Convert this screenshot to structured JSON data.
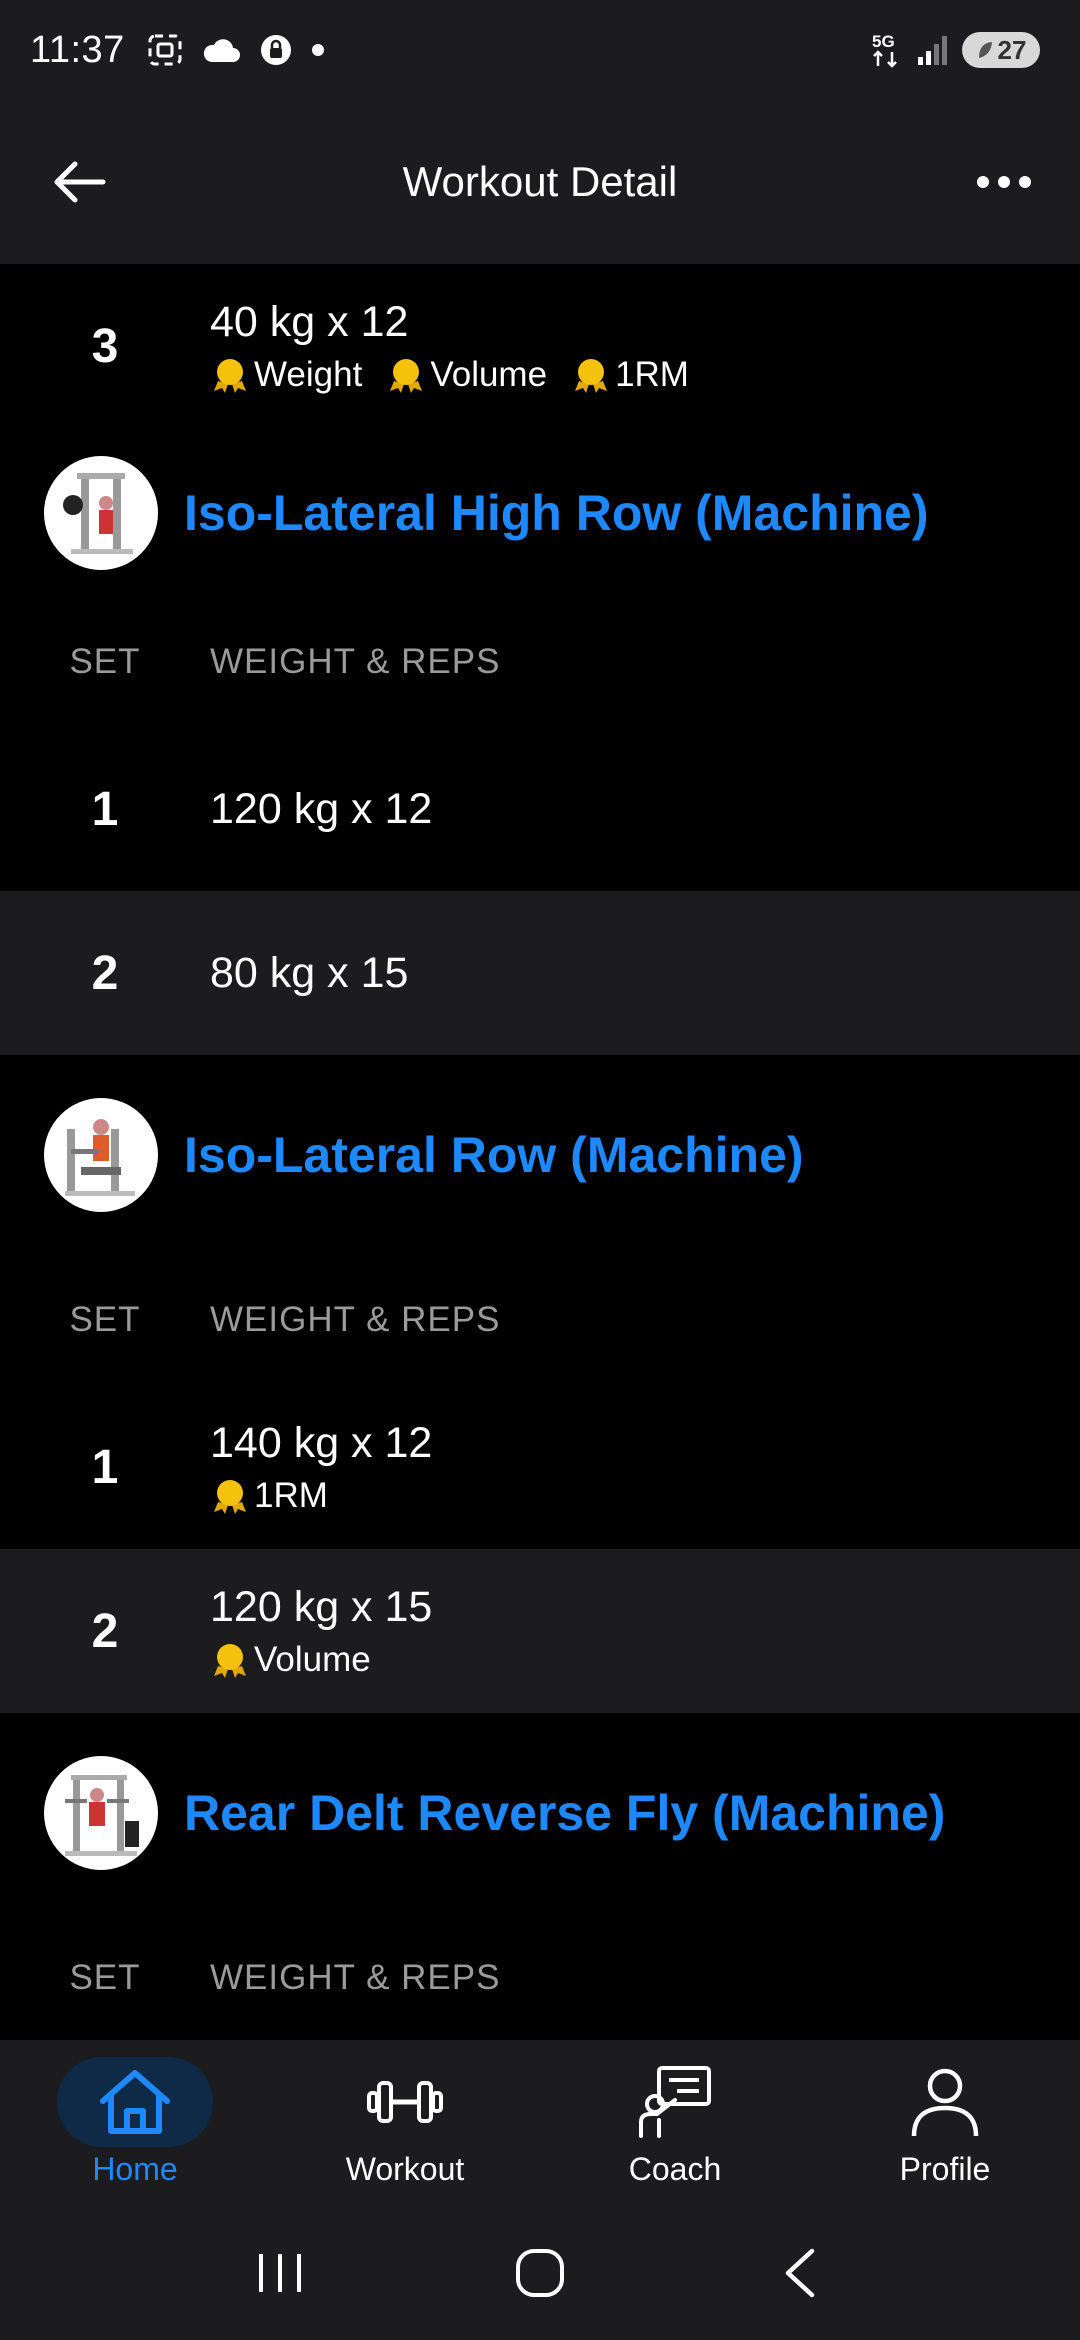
{
  "status_bar": {
    "time": "11:37",
    "network": "5G",
    "battery": "27"
  },
  "app_bar": {
    "title": "Workout Detail"
  },
  "top_set": {
    "number": "3",
    "value": "40 kg x 12",
    "badges": [
      "Weight",
      "Volume",
      "1RM"
    ]
  },
  "exercises": [
    {
      "name": "Iso-Lateral High Row (Machine)",
      "col_set": "SET",
      "col_weight_reps": "WEIGHT & REPS",
      "sets": [
        {
          "number": "1",
          "value": "120 kg x 12"
        },
        {
          "number": "2",
          "value": "80 kg x 15"
        }
      ]
    },
    {
      "name": "Iso-Lateral Row (Machine)",
      "col_set": "SET",
      "col_weight_reps": "WEIGHT & REPS",
      "sets": [
        {
          "number": "1",
          "value": "140 kg x 12",
          "badge": "1RM"
        },
        {
          "number": "2",
          "value": "120 kg x 15",
          "badge": "Volume"
        }
      ]
    },
    {
      "name": "Rear Delt Reverse Fly (Machine)",
      "col_set": "SET",
      "col_weight_reps": "WEIGHT & REPS",
      "sets": []
    }
  ],
  "bottom_nav": {
    "items": [
      {
        "label": "Home",
        "icon": "home-icon",
        "active": true
      },
      {
        "label": "Workout",
        "icon": "dumbbell-icon",
        "active": false
      },
      {
        "label": "Coach",
        "icon": "coach-icon",
        "active": false
      },
      {
        "label": "Profile",
        "icon": "profile-icon",
        "active": false
      }
    ]
  },
  "colors": {
    "accent": "#1e88ff",
    "background": "#000000",
    "surface": "#1c1c1e",
    "medal": "#f4c20d",
    "muted_text": "#9a9a9a"
  }
}
